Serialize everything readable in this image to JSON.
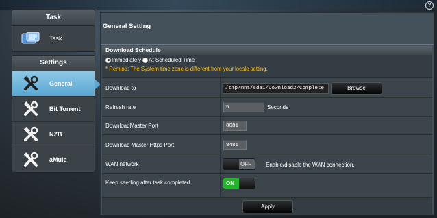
{
  "help_icon": "question-mark-icon",
  "nav": {
    "task_section": {
      "heading": "Task",
      "items": [
        {
          "label": "Task",
          "icon": "task-list-icon"
        }
      ]
    },
    "settings_section": {
      "heading": "Settings",
      "items": [
        {
          "label": "General",
          "icon": "tools-icon",
          "active": true
        },
        {
          "label": "Bit Torrent",
          "icon": "tools-icon"
        },
        {
          "label": "NZB",
          "icon": "tools-icon"
        },
        {
          "label": "aMule",
          "icon": "tools-icon"
        }
      ]
    }
  },
  "main": {
    "title": "General Setting",
    "schedule": {
      "heading": "Download Schedule",
      "option_immediately": "Immediately",
      "option_scheduled": "At Scheduled Time",
      "selected": "Immediately",
      "remind": "* Remind: The System time zone is different from your locale setting."
    },
    "fields": {
      "download_to": {
        "label": "Download to",
        "value": "/tmp/mnt/sda1/Download2/Complete",
        "button": "Browse"
      },
      "refresh_rate": {
        "label": "Refresh rate",
        "value": "5",
        "unit": "Seconds"
      },
      "dm_port": {
        "label": "DownloadMaster Port",
        "value": "8081"
      },
      "dm_https_port": {
        "label": "Download Master Https Port",
        "value": "8481"
      },
      "wan_network": {
        "label": "WAN network",
        "state": "OFF",
        "description": "Enable/disable the WAN connection."
      },
      "keep_seeding": {
        "label": "Keep seeding after task completed",
        "state": "ON"
      }
    },
    "apply_label": "Apply"
  },
  "colors": {
    "accent_active_nav": "#5aa7d2",
    "toggle_on": "#26b32e",
    "remind_text": "#ffc02a"
  }
}
